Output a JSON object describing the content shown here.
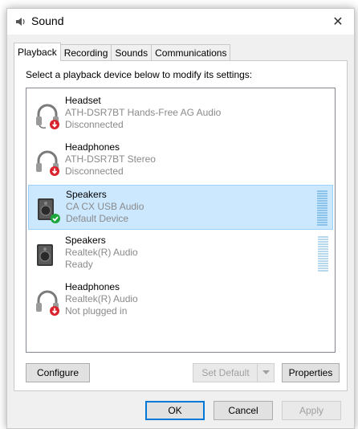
{
  "window": {
    "title": "Sound",
    "close_glyph": "✕"
  },
  "tabs": [
    {
      "label": "Playback",
      "active": true
    },
    {
      "label": "Recording",
      "active": false
    },
    {
      "label": "Sounds",
      "active": false
    },
    {
      "label": "Communications",
      "active": false
    }
  ],
  "playback": {
    "instruction": "Select a playback device below to modify its settings:",
    "devices": [
      {
        "name": "Headset",
        "driver": "ATH-DSR7BT Hands-Free AG Audio",
        "status": "Disconnected",
        "icon": "headset-icon",
        "badge": "red-down-arrow",
        "selected": false
      },
      {
        "name": "Headphones",
        "driver": "ATH-DSR7BT Stereo",
        "status": "Disconnected",
        "icon": "headphones-icon",
        "badge": "red-down-arrow",
        "selected": false
      },
      {
        "name": "Speakers",
        "driver": "CA CX USB Audio",
        "status": "Default Device",
        "icon": "speaker-icon",
        "badge": "green-check",
        "selected": true
      },
      {
        "name": "Speakers",
        "driver": "Realtek(R) Audio",
        "status": "Ready",
        "icon": "speaker-icon",
        "badge": "none",
        "selected": false
      },
      {
        "name": "Headphones",
        "driver": "Realtek(R) Audio",
        "status": "Not plugged in",
        "icon": "headphones-icon",
        "badge": "red-down-arrow",
        "selected": false
      }
    ],
    "configure_label": "Configure",
    "set_default_label": "Set Default",
    "properties_label": "Properties"
  },
  "footer": {
    "ok_label": "OK",
    "cancel_label": "Cancel",
    "apply_label": "Apply"
  },
  "colors": {
    "selection_bg": "#cce8ff",
    "selection_border": "#99d1ff",
    "default_badge": "#1aa73b",
    "unavailable_badge": "#d9232d",
    "primary_border": "#0078d7"
  }
}
